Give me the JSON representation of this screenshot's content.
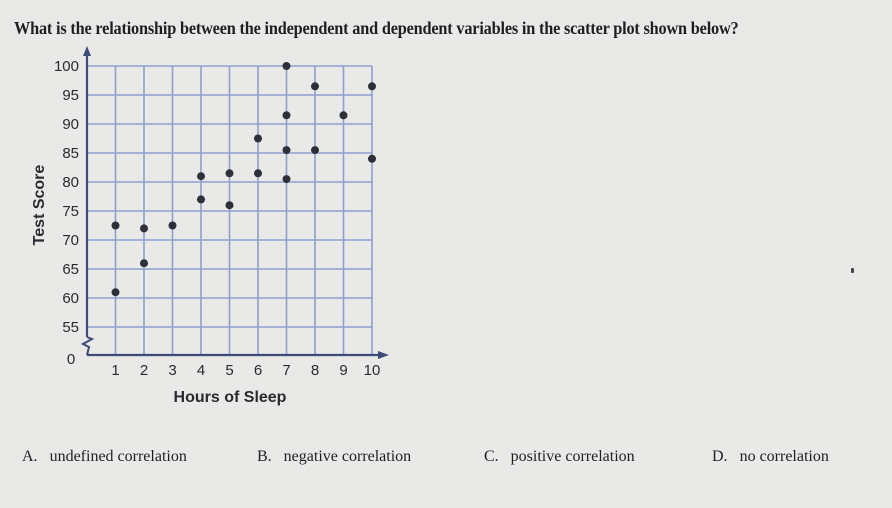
{
  "question": "What is the relationship between the independent and dependent variables in the scatter plot shown below?",
  "choices": [
    {
      "letter": "A.",
      "text": "undefined correlation"
    },
    {
      "letter": "B.",
      "text": "negative correlation"
    },
    {
      "letter": "C.",
      "text": "positive correlation"
    },
    {
      "letter": "D.",
      "text": "no correlation"
    }
  ],
  "colors": {
    "grid": "#8f9fcf",
    "axis": "#3e4a78",
    "point": "#2d3038"
  },
  "chart_data": {
    "type": "scatter",
    "title": "",
    "xlabel": "Hours of Sleep",
    "ylabel": "Test Score",
    "xlim": [
      0,
      10
    ],
    "ylim": [
      55,
      100
    ],
    "y_axis_break": true,
    "x_ticks": [
      "0",
      "1",
      "2",
      "3",
      "4",
      "5",
      "6",
      "7",
      "8",
      "9",
      "10"
    ],
    "y_ticks": [
      "100",
      "95",
      "90",
      "85",
      "80",
      "75",
      "70",
      "65",
      "60",
      "55"
    ],
    "grid": true,
    "points": [
      {
        "x": 1,
        "y": 72.5
      },
      {
        "x": 1,
        "y": 61
      },
      {
        "x": 2,
        "y": 72
      },
      {
        "x": 2,
        "y": 66
      },
      {
        "x": 3,
        "y": 72.5
      },
      {
        "x": 4,
        "y": 81
      },
      {
        "x": 4,
        "y": 77
      },
      {
        "x": 5,
        "y": 81.5
      },
      {
        "x": 5,
        "y": 76
      },
      {
        "x": 6,
        "y": 87.5
      },
      {
        "x": 6,
        "y": 81.5
      },
      {
        "x": 7,
        "y": 100
      },
      {
        "x": 7,
        "y": 91.5
      },
      {
        "x": 7,
        "y": 85.5
      },
      {
        "x": 7,
        "y": 80.5
      },
      {
        "x": 8,
        "y": 96.5
      },
      {
        "x": 8,
        "y": 85.5
      },
      {
        "x": 9,
        "y": 91.5
      },
      {
        "x": 10,
        "y": 96.5
      },
      {
        "x": 10,
        "y": 84
      }
    ]
  }
}
